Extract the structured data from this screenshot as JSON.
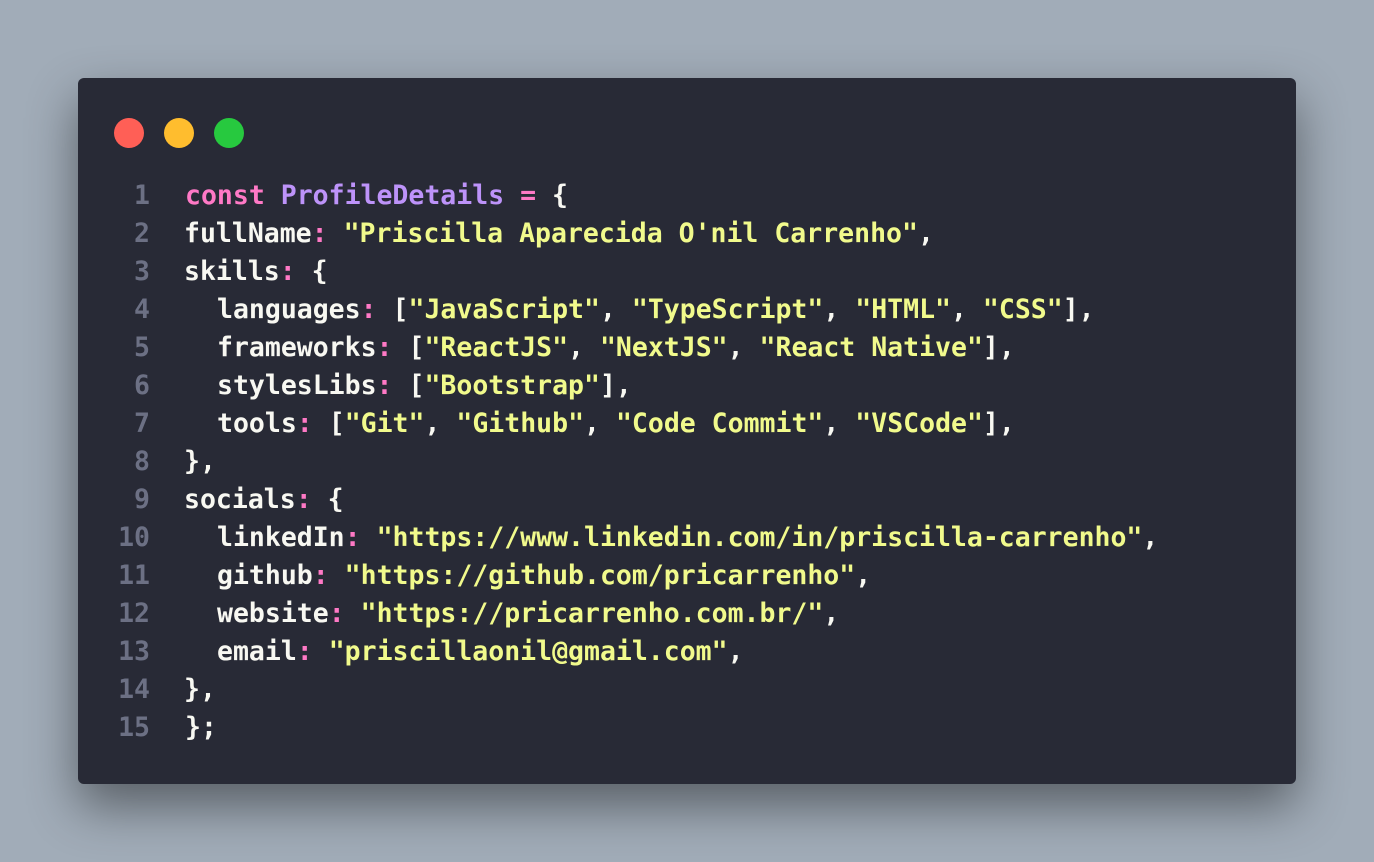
{
  "colors": {
    "background": "#a1acb8",
    "window": "#282a36",
    "close": "#ff5f56",
    "minimize": "#ffbd2e",
    "maximize": "#27c93f",
    "keyword": "#ff79c6",
    "identifier": "#bd93f9",
    "text": "#f8f8f2",
    "string": "#f1fa8c",
    "line_number": "#6c7084"
  },
  "line_numbers": [
    "1",
    "2",
    "3",
    "4",
    "5",
    "6",
    "7",
    "8",
    "9",
    "10",
    "11",
    "12",
    "13",
    "14",
    "15"
  ],
  "code": {
    "l1": {
      "kw": "const",
      "name": "ProfileDetails",
      "op": "=",
      "brace": "{"
    },
    "l2": {
      "key": "fullName",
      "value": "\"Priscilla Aparecida O'nil Carrenho\""
    },
    "l3": {
      "key": "skills",
      "brace": "{"
    },
    "l4": {
      "key": "languages",
      "items": [
        "\"JavaScript\"",
        "\"TypeScript\"",
        "\"HTML\"",
        "\"CSS\""
      ]
    },
    "l5": {
      "key": "frameworks",
      "items": [
        "\"ReactJS\"",
        "\"NextJS\"",
        "\"React Native\""
      ]
    },
    "l6": {
      "key": "stylesLibs",
      "items": [
        "\"Bootstrap\""
      ]
    },
    "l7": {
      "key": "tools",
      "items": [
        "\"Git\"",
        "\"Github\"",
        "\"Code Commit\"",
        "\"VSCode\""
      ]
    },
    "l8": {
      "close": "},"
    },
    "l9": {
      "key": "socials",
      "brace": "{"
    },
    "l10": {
      "key": "linkedIn",
      "value": "\"https://www.linkedin.com/in/priscilla-carrenho\""
    },
    "l11": {
      "key": "github",
      "value": "\"https://github.com/pricarrenho\""
    },
    "l12": {
      "key": "website",
      "value": "\"https://pricarrenho.com.br/\""
    },
    "l13": {
      "key": "email",
      "value": "\"priscillaonil@gmail.com\""
    },
    "l14": {
      "close": "},"
    },
    "l15": {
      "close": "};"
    }
  }
}
